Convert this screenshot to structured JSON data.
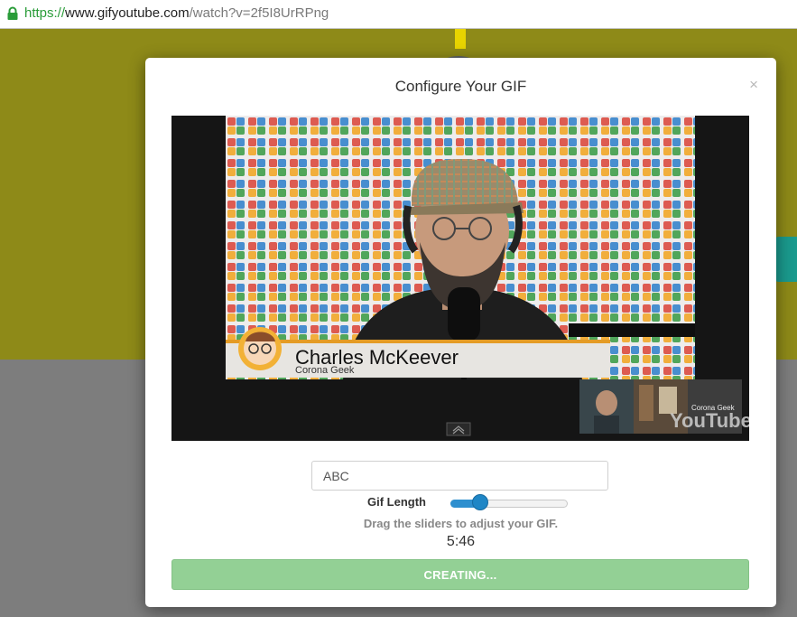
{
  "browser": {
    "url_scheme": "https://",
    "url_host": "www.gifyoutube.com",
    "url_path": "/watch?v=2f5I8UrRPng"
  },
  "modal": {
    "title": "Configure Your GIF",
    "close_glyph": "×",
    "caption_input_value": "ABC",
    "gif_length_label": "Gif Length",
    "gif_length_level": 0.22,
    "hint": "Drag the sliders to adjust your GIF.",
    "time": "5:46",
    "create_button_label": "CREATING..."
  },
  "video": {
    "lower_third_name": "Charles McKeever",
    "lower_third_subtitle": "Corona Geek",
    "watermark_label": "Corona Geek",
    "youtube_logo_text": "YouTube"
  },
  "colors": {
    "accent": "#2e8fcf",
    "create_button": "#93d095",
    "page_background_top": "#8e8a18"
  },
  "icons": {
    "lock": "lock-icon",
    "close": "close-icon",
    "expand": "chevron-up-icon"
  }
}
